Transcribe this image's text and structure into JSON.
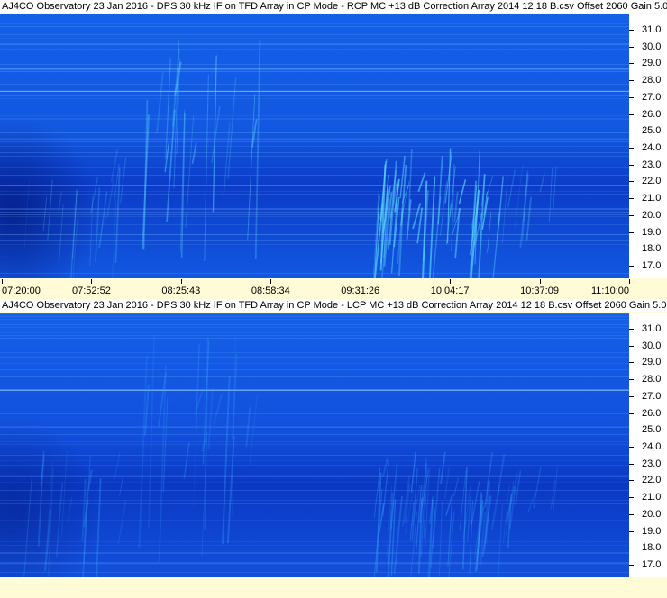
{
  "panels": [
    {
      "title": "AJ4CO Observatory 23 Jan 2016 - DPS 30 kHz IF on TFD Array in CP Mode - RCP  MC +13 dB  Correction Array 2014 12 18 B.csv  Offset 2060  Gain 5.0",
      "polarization": "RCP",
      "freq_ticks": [
        "31.0",
        "30.0",
        "29.0",
        "28.0",
        "27.0",
        "26.0",
        "25.0",
        "24.0",
        "23.0",
        "22.0",
        "21.0",
        "20.0",
        "19.0",
        "18.0",
        "17.0"
      ],
      "time_ticks": [
        "07:20:00",
        "07:52:52",
        "08:25:43",
        "08:58:34",
        "09:31:26",
        "10:04:17",
        "10:37:09",
        "11:10:00"
      ],
      "colors": {
        "base": "#1257e0",
        "band_dark": "#0b3cc8",
        "burst": "#5ad6ff",
        "line": "#7fb8ff"
      }
    },
    {
      "title": "AJ4CO Observatory 23 Jan 2016 - DPS 30 kHz IF on TFD Array in CP Mode - LCP  MC +13 dB  Correction Array 2014 12 18 B.csv  Offset 2060  Gain 5.0",
      "polarization": "LCP",
      "freq_ticks": [
        "31.0",
        "30.0",
        "29.0",
        "28.0",
        "27.0",
        "26.0",
        "25.0",
        "24.0",
        "23.0",
        "22.0",
        "21.0",
        "20.0",
        "19.0",
        "18.0",
        "17.0"
      ],
      "time_ticks": [],
      "colors": {
        "base": "#1250dc",
        "band_dark": "#0a38c4",
        "burst": "#3aa8ff",
        "line": "#6aa8ff"
      }
    }
  ]
}
